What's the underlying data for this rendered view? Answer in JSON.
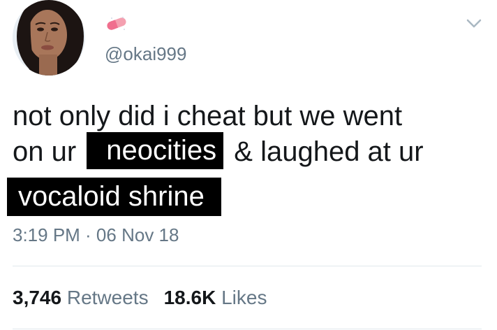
{
  "header": {
    "handle": "@okai999",
    "emoji_icon": "pill-emoji",
    "menu_icon": "chevron-down-icon"
  },
  "tweet": {
    "line1": "not only did i cheat but we went",
    "line2_prefix": "on ur",
    "line2_redacted": "neocities",
    "line2_suffix": "& laughed at ur",
    "line3_redacted": "vocaloid shrine"
  },
  "timestamp": "3:19 PM · 06 Nov 18",
  "stats": {
    "retweets_count": "3,746",
    "retweets_label": "Retweets",
    "likes_count": "18.6K",
    "likes_label": "Likes"
  },
  "colors": {
    "text": "#14171a",
    "secondary": "#657786",
    "divider": "#e1e8ed",
    "redact_bg": "#000000",
    "redact_text": "#ffffff"
  }
}
